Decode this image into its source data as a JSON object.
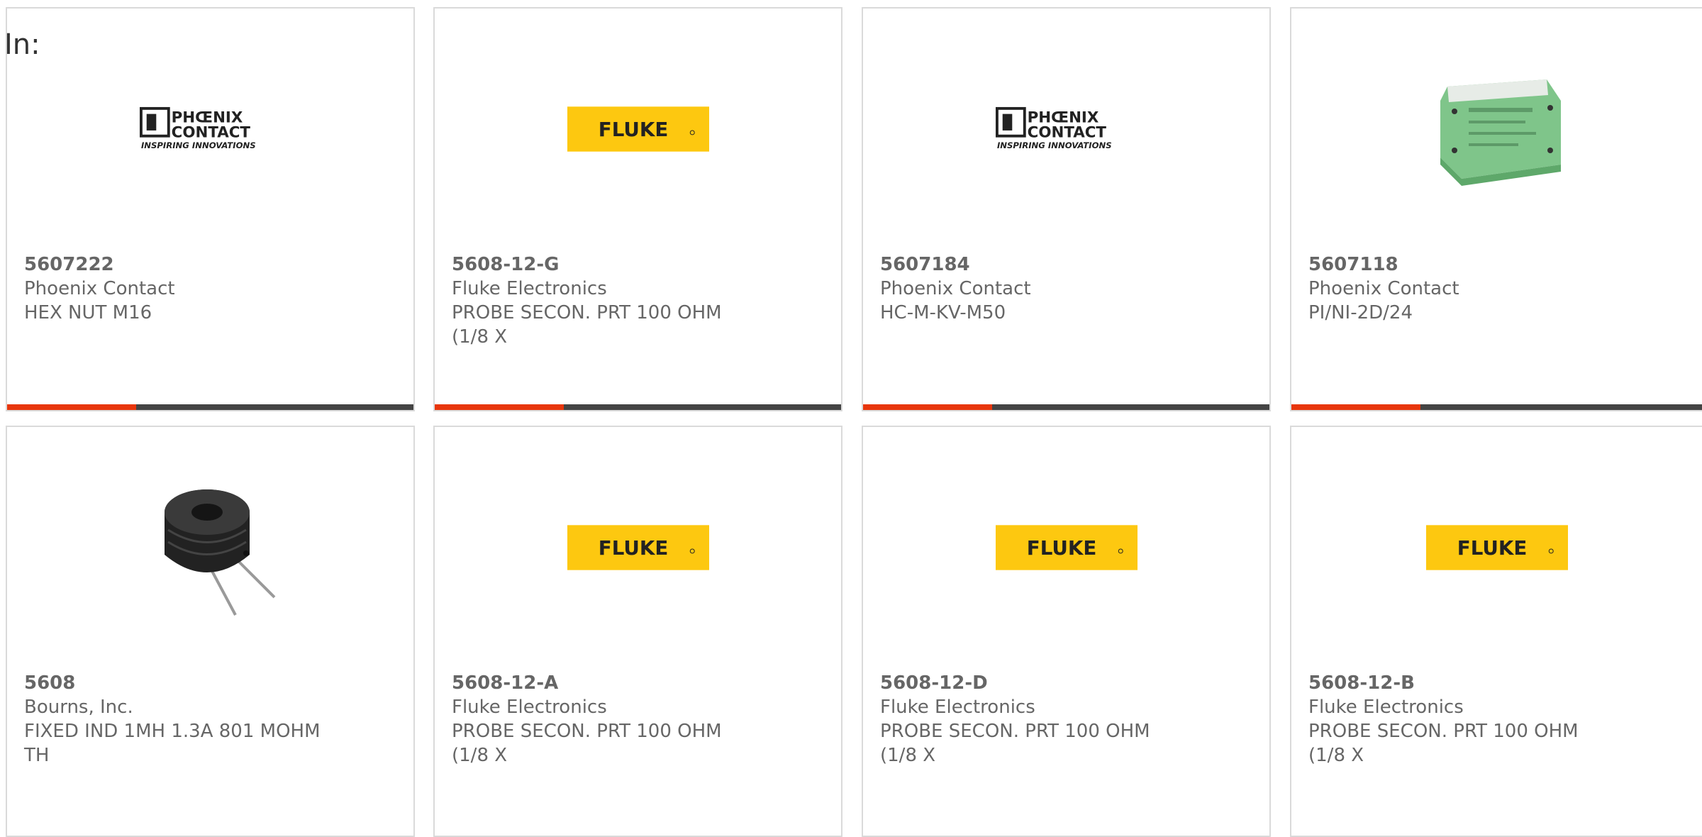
{
  "page": {
    "label": "In:"
  },
  "colors": {
    "accent": "#e8360c",
    "bar": "#444444",
    "fluke_yellow": "#fdc810",
    "text": "#666666"
  },
  "products": [
    {
      "part": "5607222",
      "manufacturer": "Phoenix Contact",
      "description": "HEX NUT M16",
      "image": "phoenix-contact-logo",
      "logo_text_1": "PHŒNIX",
      "logo_text_2": "CONTACT",
      "logo_text_3": "INSPIRING INNOVATIONS"
    },
    {
      "part": "5608-12-G",
      "manufacturer": "Fluke Electronics",
      "description": "PROBE SECON. PRT 100 OHM (1/8 X",
      "image": "fluke-logo",
      "logo_text_1": "FLUKE"
    },
    {
      "part": "5607184",
      "manufacturer": "Phoenix Contact",
      "description": "HC-M-KV-M50",
      "image": "phoenix-contact-logo",
      "logo_text_1": "PHŒNIX",
      "logo_text_2": "CONTACT",
      "logo_text_3": "INSPIRING INNOVATIONS"
    },
    {
      "part": "5607118",
      "manufacturer": "Phoenix Contact",
      "description": "PI/NI-2D/24",
      "image": "din-rail-module-photo"
    },
    {
      "part": "5608",
      "manufacturer": "Bourns, Inc.",
      "description": "FIXED IND 1MH 1.3A 801 MOHM TH",
      "image": "inductor-photo"
    },
    {
      "part": "5608-12-A",
      "manufacturer": "Fluke Electronics",
      "description": "PROBE SECON. PRT 100 OHM (1/8 X",
      "image": "fluke-logo",
      "logo_text_1": "FLUKE"
    },
    {
      "part": "5608-12-D",
      "manufacturer": "Fluke Electronics",
      "description": "PROBE SECON. PRT 100 OHM (1/8 X",
      "image": "fluke-logo",
      "logo_text_1": "FLUKE"
    },
    {
      "part": "5608-12-B",
      "manufacturer": "Fluke Electronics",
      "description": "PROBE SECON. PRT 100 OHM (1/8 X",
      "image": "fluke-logo",
      "logo_text_1": "FLUKE"
    }
  ]
}
